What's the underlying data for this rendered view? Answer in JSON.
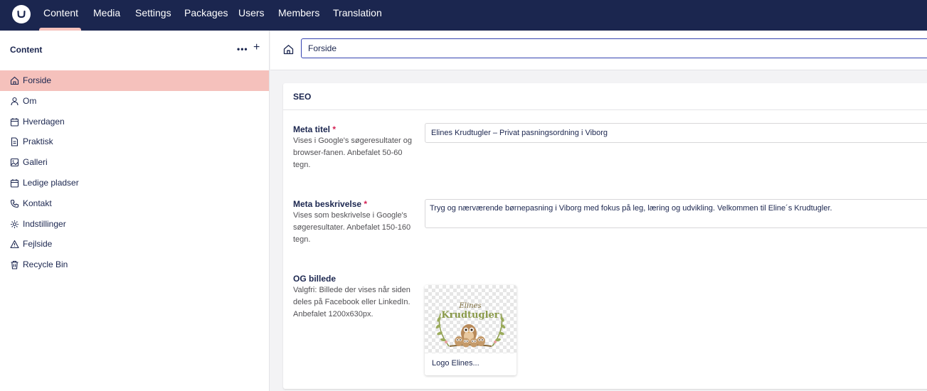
{
  "topnav": {
    "items": [
      {
        "label": "Content",
        "active": true
      },
      {
        "label": "Media"
      },
      {
        "label": "Settings"
      },
      {
        "label": "Packages"
      },
      {
        "label": "Users"
      },
      {
        "label": "Members"
      },
      {
        "label": "Translation"
      }
    ],
    "colors": {
      "bar": "#1b264f",
      "active_indicator": "#f5c1bc"
    }
  },
  "sidebar": {
    "title": "Content",
    "more_icon": "ellipsis-icon",
    "add_icon": "plus-icon",
    "items": [
      {
        "label": "Forside",
        "icon": "home-icon",
        "active": true
      },
      {
        "label": "Om",
        "icon": "user-icon"
      },
      {
        "label": "Hverdagen",
        "icon": "calendar-icon"
      },
      {
        "label": "Praktisk",
        "icon": "document-icon"
      },
      {
        "label": "Galleri",
        "icon": "image-icon"
      },
      {
        "label": "Ledige pladser",
        "icon": "calendar-icon"
      },
      {
        "label": "Kontakt",
        "icon": "phone-icon"
      },
      {
        "label": "Indstillinger",
        "icon": "gear-icon"
      },
      {
        "label": "Fejlside",
        "icon": "warning-icon"
      },
      {
        "label": "Recycle Bin",
        "icon": "trash-icon"
      }
    ]
  },
  "header": {
    "icon": "home-icon",
    "name_value": "Forside"
  },
  "seo": {
    "title": "SEO",
    "meta_title": {
      "label": "Meta titel",
      "required_mark": "*",
      "description": "Vises i Google's søgeresultater og browser-fanen. Anbefalet 50-60 tegn.",
      "value": "Elines Krudtugler – Privat pasningsordning i Viborg"
    },
    "meta_description": {
      "label": "Meta beskrivelse",
      "required_mark": "*",
      "description": "Vises som beskrivelse i Google's søgeresultater. Anbefalet 150-160 tegn.",
      "value": "Tryg og nærværende børnepasning i Viborg med fokus på leg, læring og udvikling. Velkommen til Eline´s Krudtugler."
    },
    "og_image": {
      "label": "OG billede",
      "description": "Valgfri: Billede der vises når siden deles på Facebook eller LinkedIn. Anbefalet 1200x630px.",
      "media_name": "Logo Elines...",
      "logo_text_line1": "Elines",
      "logo_text_line2": "Krudtugler"
    }
  }
}
